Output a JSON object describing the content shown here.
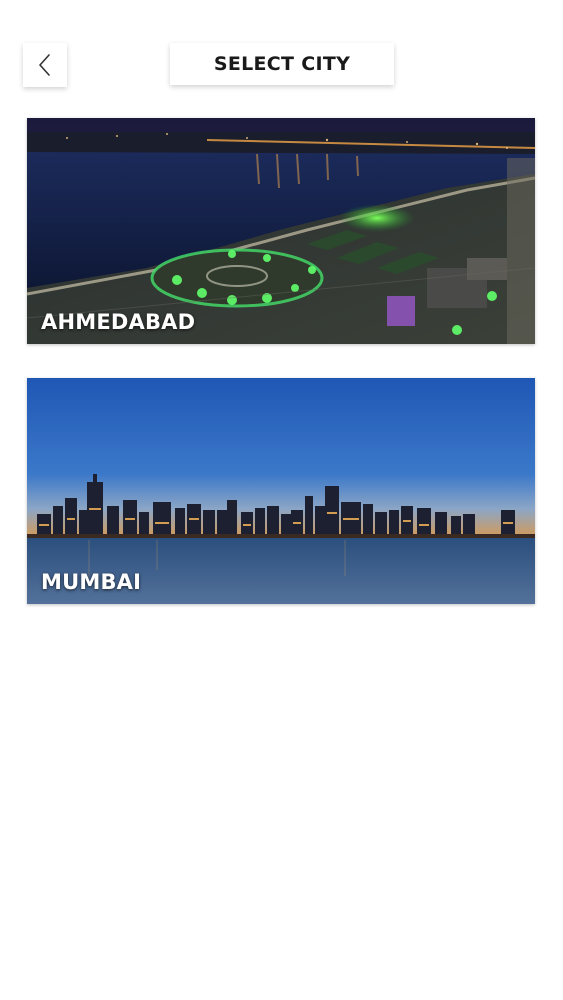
{
  "header": {
    "title": "SELECT CITY",
    "back_icon": "chevron-left-icon"
  },
  "cities": [
    {
      "name": "AHMEDABAD"
    },
    {
      "name": "MUMBAI"
    }
  ]
}
